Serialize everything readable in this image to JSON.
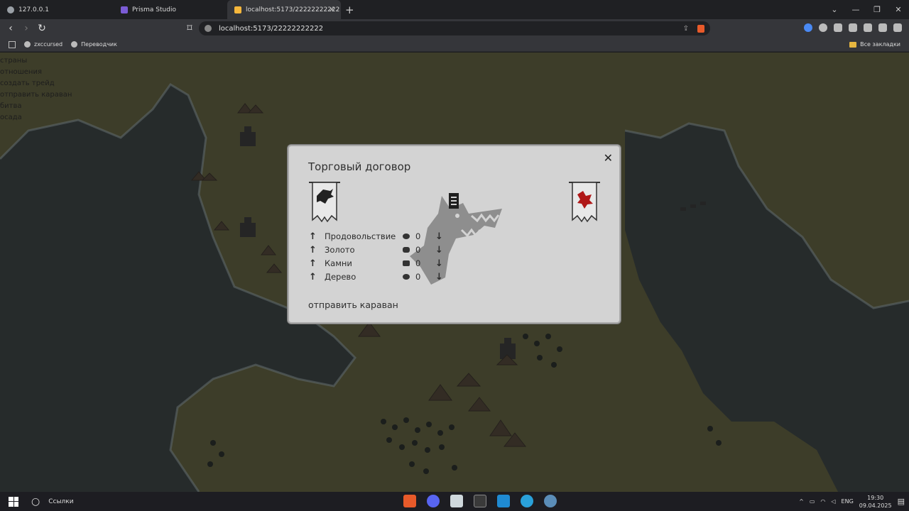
{
  "browser": {
    "tabs": [
      {
        "label": "127.0.0.1",
        "active": false,
        "color": "#9aa0a6"
      },
      {
        "label": "Prisma Studio",
        "active": false,
        "color": "#7b5cd6"
      },
      {
        "label": "localhost:5173/22222222222",
        "active": true,
        "color": "#f6b73c"
      }
    ],
    "url": "localhost:5173/22222222222",
    "bookmarks": [
      "zxccursed",
      "Переводчик"
    ],
    "all_bookmarks": "Все закладки"
  },
  "sidebar": {
    "items": [
      "страны",
      "отношения",
      "создать трейд",
      "отправить караван",
      "битва",
      "осада"
    ]
  },
  "modal": {
    "title": "Торговый договор",
    "close": "✕",
    "resources": [
      {
        "name": "Продовольствие",
        "value": "0",
        "icon": "food-icon"
      },
      {
        "name": "Золото",
        "value": "0",
        "icon": "gold-bag-icon"
      },
      {
        "name": "Камни",
        "value": "0",
        "icon": "stone-icon"
      },
      {
        "name": "Дерево",
        "value": "0",
        "icon": "wood-icon"
      }
    ],
    "up_arrow": "↑",
    "down_arrow": "↓",
    "send_caravan": "отправить караван",
    "colors": {
      "background": "#d3d3d3",
      "right_banner_accent": "#b01818"
    }
  },
  "taskbar": {
    "search": "Ссылки",
    "lang": "ENG",
    "time": "19:30",
    "date": "09.04.2025"
  }
}
